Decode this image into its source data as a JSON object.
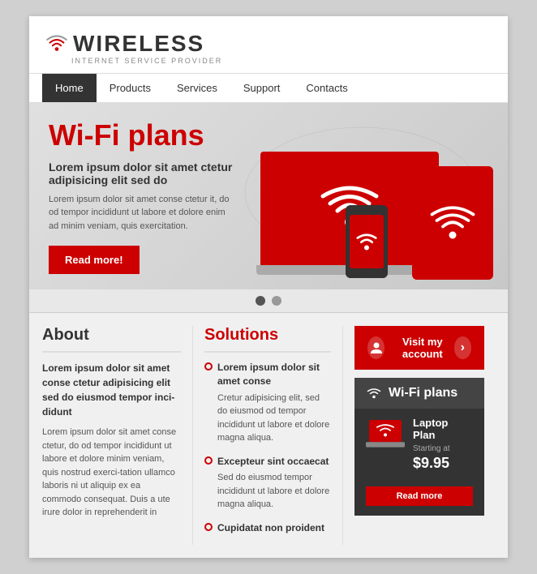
{
  "meta": {
    "title": "Wireless Internet Service Provider"
  },
  "header": {
    "logo_text": "WIRELESS",
    "logo_sub": "INTERNET SERVICE PROVIDER"
  },
  "nav": {
    "items": [
      {
        "label": "Home",
        "active": true
      },
      {
        "label": "Products",
        "active": false
      },
      {
        "label": "Services",
        "active": false
      },
      {
        "label": "Support",
        "active": false
      },
      {
        "label": "Contacts",
        "active": false
      }
    ]
  },
  "hero": {
    "title": "Wi-Fi plans",
    "subtitle": "Lorem ipsum dolor sit amet ctetur adipisicing elit sed do",
    "body": "Lorem ipsum dolor sit amet conse ctetur it, do od tempor incididunt ut labore et dolore enim ad minim veniam, quis exercitation.",
    "cta_label": "Read more!"
  },
  "slider": {
    "dots": [
      {
        "active": true
      },
      {
        "active": false
      }
    ]
  },
  "about": {
    "title": "About",
    "body_bold": "Lorem ipsum dolor sit amet conse ctetur adipisicing elit sed do eiusmod tempor inci-didunt",
    "body": "Lorem ipsum dolor sit amet conse ctetur, do od tempor incididunt ut labore et dolore minim veniam, quis nostrud exerci-tation ullamco laboris ni ut aliquip ex ea commodo consequat. Duis a ute irure dolor in reprehenderit in"
  },
  "solutions": {
    "title": "Solutions",
    "items": [
      {
        "title": "Lorem ipsum dolor sit amet conse",
        "body": "Cretur adipisicing elit, sed do eiusmod od tempor incididunt ut labore et dolore magna aliqua."
      },
      {
        "title": "Excepteur sint occaecat",
        "body": "Sed do eiusmod tempor incididunt ut labore et dolore magna aliqua."
      },
      {
        "title": "Cupidatat non proident",
        "body": ""
      }
    ]
  },
  "sidebar": {
    "visit_account_label": "Visit my account",
    "wifi_plans_title": "Wi-Fi plans",
    "plan": {
      "name": "Laptop Plan",
      "starting_label": "Starting at",
      "price": "$9.95",
      "cta_label": "Read more"
    }
  }
}
